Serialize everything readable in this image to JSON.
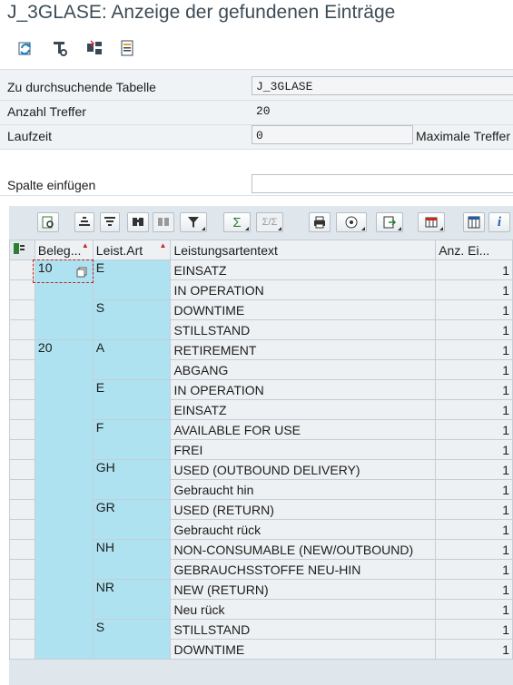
{
  "window": {
    "title": "J_3GLASE: Anzeige der gefundenen Einträge"
  },
  "toolbar": {
    "buttons": [
      {
        "name": "refresh-icon"
      },
      {
        "name": "technical-settings-icon"
      },
      {
        "name": "table-swap-icon"
      },
      {
        "name": "list-document-icon"
      }
    ]
  },
  "selection": {
    "table_label": "Zu durchsuchende Tabelle",
    "table_value": "J_3GLASE",
    "hits_label": "Anzahl Treffer",
    "hits_value": "20",
    "runtime_label": "Laufzeit",
    "runtime_value": "0",
    "max_hits_label": "Maximale Treffer",
    "insert_column_label": "Spalte einfügen"
  },
  "grid_toolbar": {
    "buttons": [
      "details-icon",
      "sort-ascending-icon",
      "sort-descending-icon",
      "find-icon",
      "find-next-icon",
      "filter-icon",
      "sum-icon",
      "subtotal-icon",
      "print-icon",
      "views-icon",
      "export-icon",
      "layout-icon",
      "spreadsheet-icon",
      "info-icon"
    ],
    "colors": {
      "accent_key": "#aee2f0",
      "sort_mark": "#cc2222"
    }
  },
  "grid": {
    "columns": [
      "Beleg...",
      "Leist.Art",
      "Leistungsartentext",
      "Anz. Ei..."
    ],
    "rows": [
      [
        "10",
        "E",
        "EINSATZ",
        "1"
      ],
      [
        "",
        "",
        "IN OPERATION",
        "1"
      ],
      [
        "",
        "S",
        "DOWNTIME",
        "1"
      ],
      [
        "",
        "",
        "STILLSTAND",
        "1"
      ],
      [
        "20",
        "A",
        "RETIREMENT",
        "1"
      ],
      [
        "",
        "",
        "ABGANG",
        "1"
      ],
      [
        "",
        "E",
        "IN OPERATION",
        "1"
      ],
      [
        "",
        "",
        "EINSATZ",
        "1"
      ],
      [
        "",
        "F",
        "AVAILABLE FOR USE",
        "1"
      ],
      [
        "",
        "",
        "FREI",
        "1"
      ],
      [
        "",
        "GH",
        "USED (OUTBOUND DELIVERY)",
        "1"
      ],
      [
        "",
        "",
        "Gebraucht hin",
        "1"
      ],
      [
        "",
        "GR",
        "USED (RETURN)",
        "1"
      ],
      [
        "",
        "",
        "Gebraucht rück",
        "1"
      ],
      [
        "",
        "NH",
        "NON-CONSUMABLE (NEW/OUTBOUND)",
        "1"
      ],
      [
        "",
        "",
        "GEBRAUCHSSTOFFE NEU-HIN",
        "1"
      ],
      [
        "",
        "NR",
        "NEW (RETURN)",
        "1"
      ],
      [
        "",
        "",
        "Neu rück",
        "1"
      ],
      [
        "",
        "S",
        "STILLSTAND",
        "1"
      ],
      [
        "",
        "",
        "DOWNTIME",
        "1"
      ]
    ]
  }
}
